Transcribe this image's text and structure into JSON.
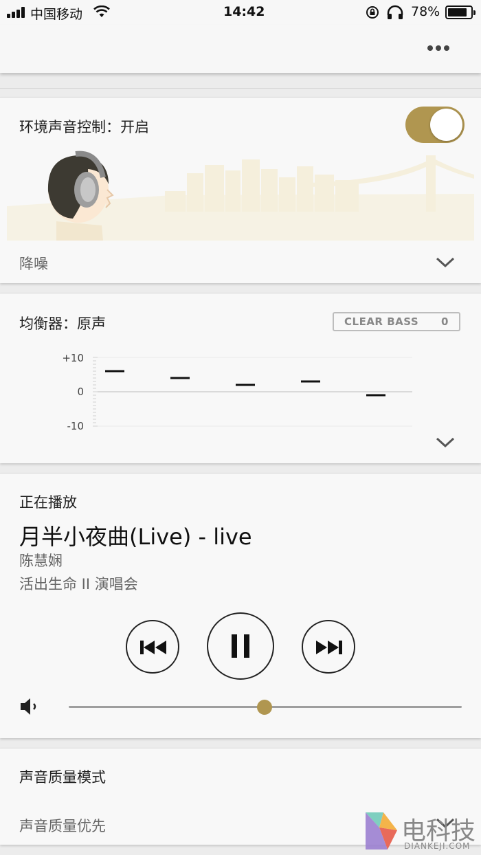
{
  "status_bar": {
    "carrier": "中国移动",
    "time": "14:42",
    "battery": "78%"
  },
  "header": {
    "more_icon": "more-horizontal-icon"
  },
  "ambient": {
    "title": "环境声音控制：开启",
    "toggle_on": true,
    "mode": "降噪",
    "accent_color": "#b09650"
  },
  "equalizer": {
    "title": "均衡器：原声",
    "clear_bass_label": "CLEAR BASS",
    "clear_bass_value": "0",
    "ticks": [
      "+10",
      "0",
      "-10"
    ],
    "bands": [
      6,
      4,
      2,
      3,
      -1
    ]
  },
  "now_playing": {
    "heading": "正在播放",
    "track": "月半小夜曲(Live) - live",
    "artist": "陈慧娴",
    "album": "活出生命 II 演唱会",
    "volume": 0.5
  },
  "quality": {
    "title": "声音质量模式",
    "value": "声音质量优先"
  },
  "watermark": {
    "cn": "电科技",
    "en": "DIANKEJI.COM"
  }
}
